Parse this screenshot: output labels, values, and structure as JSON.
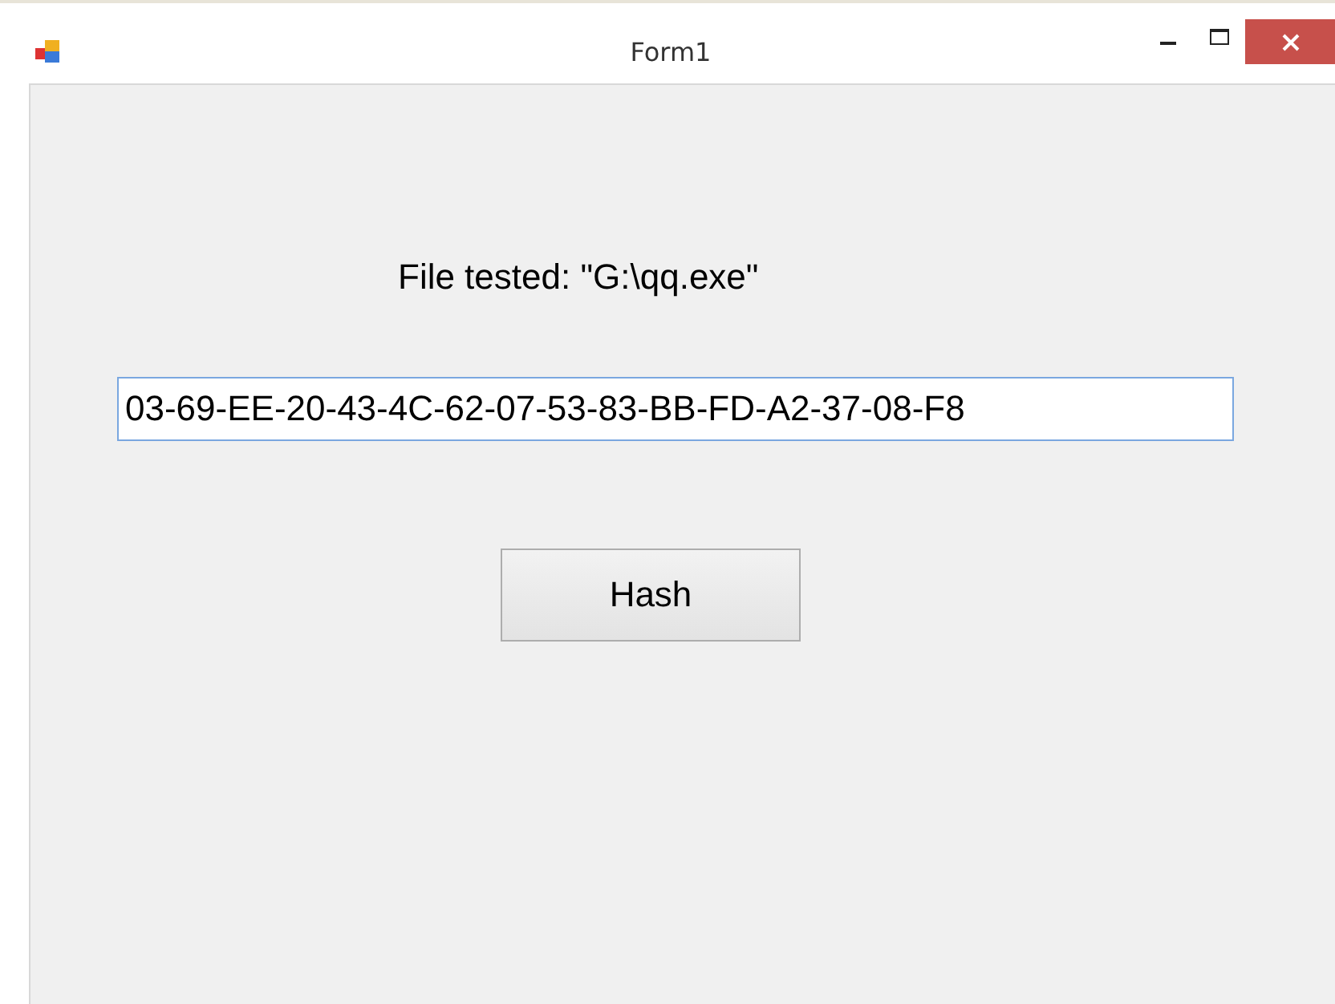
{
  "window": {
    "title": "Form1"
  },
  "label": "File tested: \"G:\\qq.exe\"",
  "hash_field": {
    "value": "03-69-EE-20-43-4C-62-07-53-83-BB-FD-A2-37-08-F8"
  },
  "buttons": [
    {
      "label": "Hash"
    }
  ]
}
